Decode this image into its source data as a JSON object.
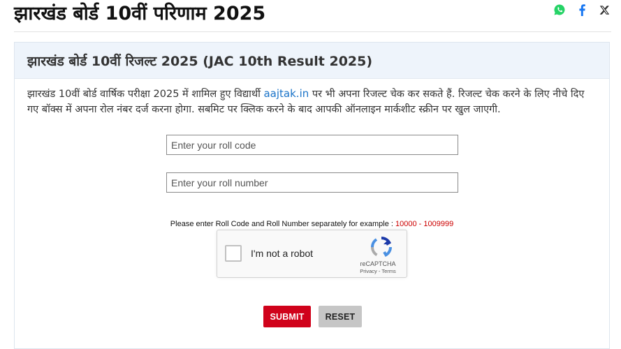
{
  "page": {
    "title": "झारखंड बोर्ड 10वीं परिणाम 2025"
  },
  "share": {
    "icons": [
      "whatsapp-icon",
      "facebook-icon",
      "x-twitter-icon"
    ],
    "colors": {
      "whatsapp": "#25d366",
      "facebook": "#1877f2",
      "x": "#000000"
    }
  },
  "result_box": {
    "heading": "झारखंड बोर्ड 10वीं रिजल्ट 2025 (JAC 10th Result 2025)",
    "desc_before_link": "झारखंड 10वीं बोर्ड वार्षिक परीक्षा 2025 में शामिल हुए विद्यार्थी ",
    "link_text": "aajtak.in",
    "desc_after_link": " पर भी अपना रिजल्ट चेक कर सकते हैं. रिजल्ट चेक करने के लिए नीचे दिए गए बॉक्स में अपना रोल नंबर दर्ज करना होगा. सबमिट पर क्लिक करने के बाद आपकी ऑनलाइन मार्कशीट स्क्रीन पर खुल जाएगी."
  },
  "form": {
    "roll_code_placeholder": "Enter your roll code",
    "roll_number_placeholder": "Enter your roll number",
    "hint_text": "Please enter Roll Code and Roll Number separately for example : ",
    "hint_example": "10000 - 1009999",
    "submit_label": "SUBMIT",
    "reset_label": "RESET"
  },
  "captcha": {
    "label": "I'm not a robot",
    "brand": "reCAPTCHA",
    "links": "Privacy - Terms"
  },
  "colors": {
    "accent_red": "#d0021b",
    "link_blue": "#1a73c8",
    "header_bg": "#eef4fb"
  }
}
